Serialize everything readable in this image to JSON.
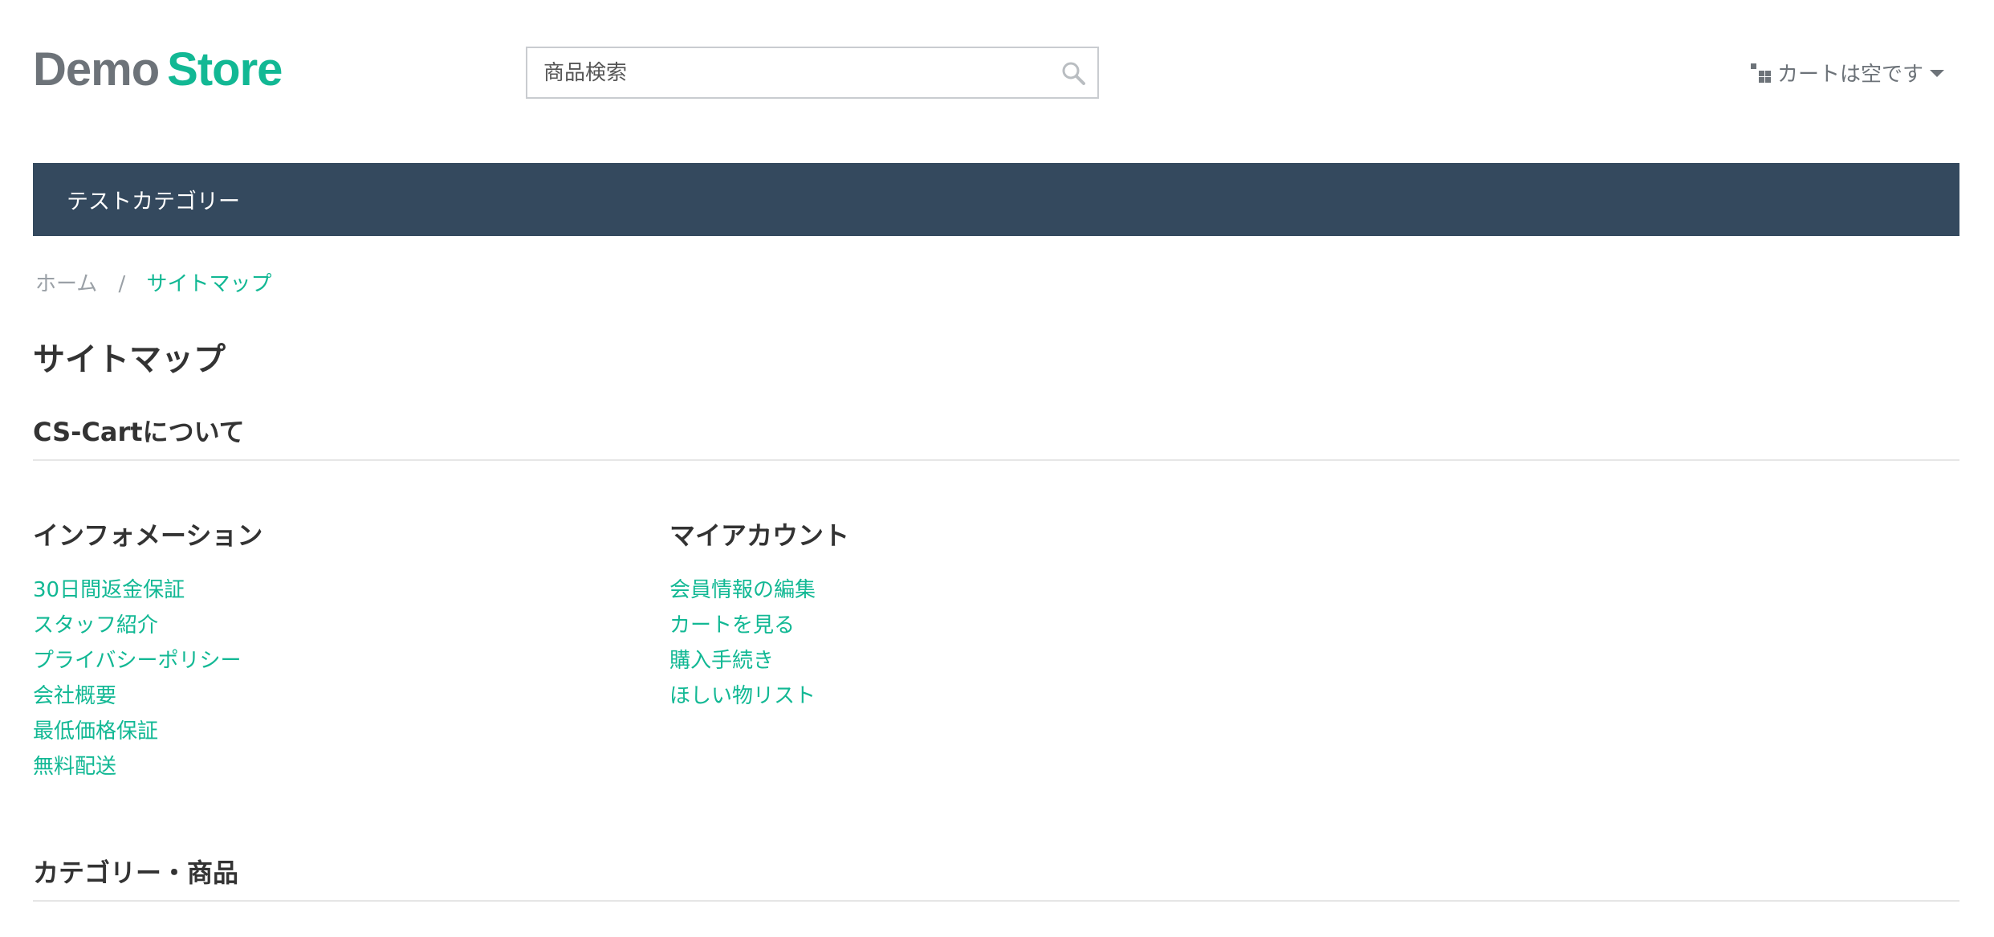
{
  "header": {
    "logo": {
      "part1": "Demo",
      "part2": "Store"
    },
    "search": {
      "placeholder": "商品検索",
      "icon": "search-icon"
    },
    "cart": {
      "label": "カートは空です",
      "icon": "cart-blocks-icon"
    }
  },
  "nav": {
    "items": [
      "テストカテゴリー"
    ]
  },
  "breadcrumb": {
    "home": "ホーム",
    "separator": "/",
    "current": "サイトマップ"
  },
  "page": {
    "title": "サイトマップ",
    "sections": {
      "about": "CS-Cartについて",
      "categories": "カテゴリー・商品"
    }
  },
  "columns": {
    "info": {
      "title": "インフォメーション",
      "links": [
        "30日間返金保証",
        "スタッフ紹介",
        "プライバシーポリシー",
        "会社概要",
        "最低価格保証",
        "無料配送"
      ]
    },
    "account": {
      "title": "マイアカウント",
      "links": [
        "会員情報の編集",
        "カートを見る",
        "購入手続き",
        "ほしい物リスト"
      ]
    }
  },
  "colors": {
    "accent": "#12b894",
    "nav_bg": "#34495e",
    "logo_gray": "#6d7379"
  }
}
